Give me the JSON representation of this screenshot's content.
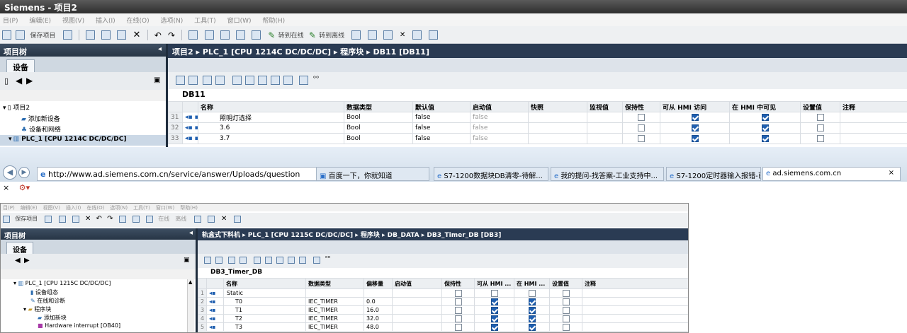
{
  "top": {
    "title": "Siemens - 项目2",
    "menu": [
      "目(P)",
      "编辑(E)",
      "视图(V)",
      "插入(I)",
      "在线(O)",
      "选项(N)",
      "工具(T)",
      "窗口(W)",
      "帮助(H)"
    ],
    "toolbar": {
      "save_project": "保存项目",
      "go_online": "转到在线",
      "go_offline": "转到离线"
    },
    "tree_title": "项目树",
    "tab": "设备",
    "tree": [
      {
        "label": "项目2",
        "icon": "document-icon"
      },
      {
        "label": "添加新设备",
        "icon": "add-device-icon"
      },
      {
        "label": "设备和网络",
        "icon": "network-icon"
      },
      {
        "label": "PLC_1 [CPU 1214C DC/DC/DC]",
        "icon": "plc-icon"
      }
    ],
    "breadcrumb": "项目2 ▸ PLC_1 [CPU 1214C DC/DC/DC] ▸ 程序块 ▸ DB11 [DB11]",
    "db_name": "DB11",
    "columns": [
      "名称",
      "数据类型",
      "默认值",
      "启动值",
      "快照",
      "监视值",
      "保持性",
      "可从 HMI 访问",
      "在 HMI 中可见",
      "设置值",
      "注释"
    ],
    "rows": [
      {
        "num": "31",
        "name": "照明灯选择",
        "type": "Bool",
        "default": "false",
        "start": "false",
        "retain": false,
        "hmi_access": true,
        "hmi_visible": true,
        "setpoint": false
      },
      {
        "num": "32",
        "name": "3.6",
        "type": "Bool",
        "default": "false",
        "start": "false",
        "retain": false,
        "hmi_access": true,
        "hmi_visible": true,
        "setpoint": false
      },
      {
        "num": "33",
        "name": "3.7",
        "type": "Bool",
        "default": "false",
        "start": "false",
        "retain": false,
        "hmi_access": true,
        "hmi_visible": true,
        "setpoint": false
      }
    ]
  },
  "browser": {
    "url": "http://www.ad.siemens.com.cn/service/answer/Uploads/question",
    "tabs": [
      {
        "label": "百度一下，你就知道",
        "active": false
      },
      {
        "label": "S7-1200数据块DB清零-待解...",
        "active": false
      },
      {
        "label": "我的提问-找答案-工业支持中...",
        "active": false
      },
      {
        "label": "S7-1200定时器输入报错-已解...",
        "active": false
      },
      {
        "label": "ad.siemens.com.cn",
        "active": true
      }
    ],
    "close": "×"
  },
  "bottom": {
    "menu": [
      "目(P)",
      "编辑(E)",
      "视图(V)",
      "插入(I)",
      "在线(O)",
      "选项(N)",
      "工具(T)",
      "窗口(W)",
      "帮助(H)"
    ],
    "toolbar": {
      "save_project": "保存项目",
      "online": "在线",
      "offline": "离线"
    },
    "tree_title": "项目树",
    "tab": "设备",
    "tree": [
      {
        "label": "PLC_1 [CPU 1215C DC/DC/DC]",
        "icon": "plc-icon"
      },
      {
        "label": "设备组态",
        "icon": "device-config-icon"
      },
      {
        "label": "在线和诊断",
        "icon": "diagnostics-icon"
      },
      {
        "label": "程序块",
        "icon": "folder-icon"
      },
      {
        "label": "添加新块",
        "icon": "add-block-icon"
      },
      {
        "label": "Hardware interrupt [OB40]",
        "icon": "ob-icon"
      }
    ],
    "breadcrumb": "轨盒式下料机 ▸ PLC_1 [CPU 1215C DC/DC/DC] ▸ 程序块 ▸ DB_DATA ▸ DB3_Timer_DB [DB3]",
    "db_name": "DB3_Timer_DB",
    "columns": [
      "名称",
      "数据类型",
      "偏移量",
      "启动值",
      "保持性",
      "可从 HMI ...",
      "在 HMI ...",
      "设置值",
      "注释"
    ],
    "rows": [
      {
        "num": "1",
        "name": "Static",
        "type": "",
        "offset": "",
        "retain": false,
        "hmi_access": false,
        "hmi_visible": false,
        "setpoint": false
      },
      {
        "num": "2",
        "name": "T0",
        "type": "IEC_TIMER",
        "offset": "0.0",
        "retain": false,
        "hmi_access": true,
        "hmi_visible": true,
        "setpoint": false
      },
      {
        "num": "3",
        "name": "T1",
        "type": "IEC_TIMER",
        "offset": "16.0",
        "retain": false,
        "hmi_access": true,
        "hmi_visible": true,
        "setpoint": false
      },
      {
        "num": "4",
        "name": "T2",
        "type": "IEC_TIMER",
        "offset": "32.0",
        "retain": false,
        "hmi_access": true,
        "hmi_visible": true,
        "setpoint": false
      },
      {
        "num": "5",
        "name": "T3",
        "type": "IEC_TIMER",
        "offset": "48.0",
        "retain": false,
        "hmi_access": true,
        "hmi_visible": true,
        "setpoint": false
      }
    ]
  }
}
